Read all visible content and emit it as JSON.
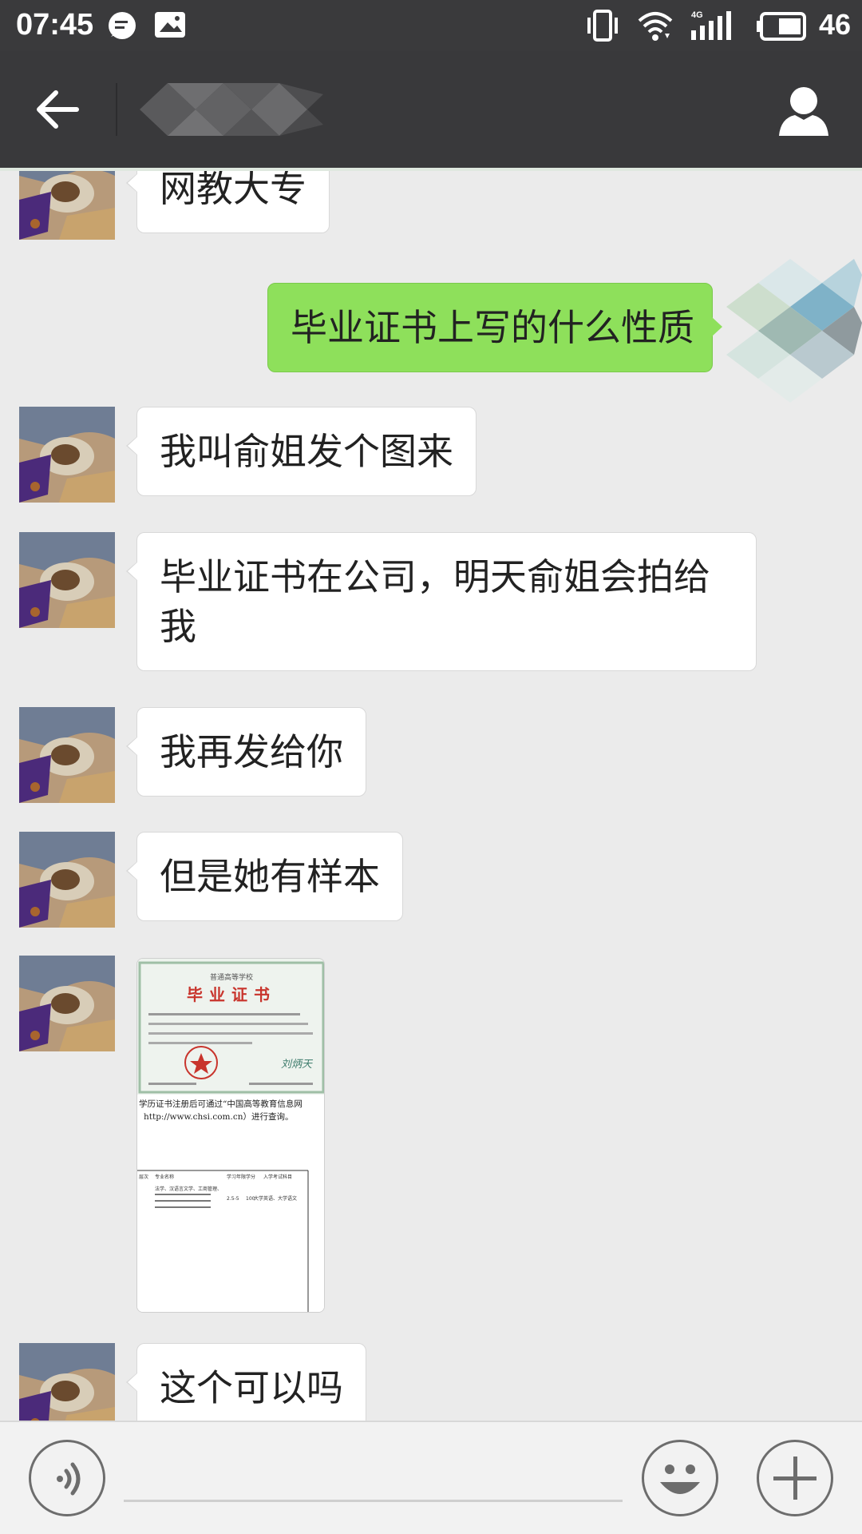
{
  "status_bar": {
    "time": "07:45",
    "battery_percent": "46",
    "icons": [
      "message-notification-icon",
      "image-notification-icon",
      "vibrate-icon",
      "wifi-icon",
      "4g-signal-icon",
      "battery-icon"
    ],
    "network_label": "4G"
  },
  "header": {
    "back_icon": "back-arrow-icon",
    "contact_name": "",
    "profile_icon": "person-icon"
  },
  "messages": [
    {
      "side": "left",
      "type": "text",
      "text": "网教大专"
    },
    {
      "side": "right",
      "type": "text",
      "text": "毕业证书上写的什么性质"
    },
    {
      "side": "left",
      "type": "text",
      "text": "我叫俞姐发个图来"
    },
    {
      "side": "left",
      "type": "text",
      "text": "毕业证书在公司，明天俞姐会拍给我"
    },
    {
      "side": "left",
      "type": "text",
      "text": "我再发给你"
    },
    {
      "side": "left",
      "type": "text",
      "text": "但是她有样本"
    },
    {
      "side": "left",
      "type": "image",
      "image": {
        "school_header": "普通高等学校",
        "title": "毕业证书",
        "signature": "刘炳天",
        "note": "学历证书注册后可通过“中国高等教育信息网",
        "note_url": "http://www.chsi.com.cn）进行查询。",
        "table_headers": [
          "层次",
          "专业名称",
          "学习年限",
          "学分",
          "入学考试科目"
        ],
        "table_row": [
          "法学、汉语言文学、工商管理、",
          "2.5-5",
          "100",
          "大学英语、大学语文"
        ]
      }
    },
    {
      "side": "left",
      "type": "text",
      "text": "这个可以吗"
    }
  ],
  "input_bar": {
    "voice_icon": "voice-icon",
    "input_value": "",
    "emoji_icon": "emoji-icon",
    "plus_icon": "plus-icon"
  },
  "colors": {
    "status_bar": "#3a3a3c",
    "header": "#39393b",
    "chat_background": "#ebebeb",
    "sent_bubble": "#8ee05b",
    "received_bubble": "#ffffff"
  }
}
